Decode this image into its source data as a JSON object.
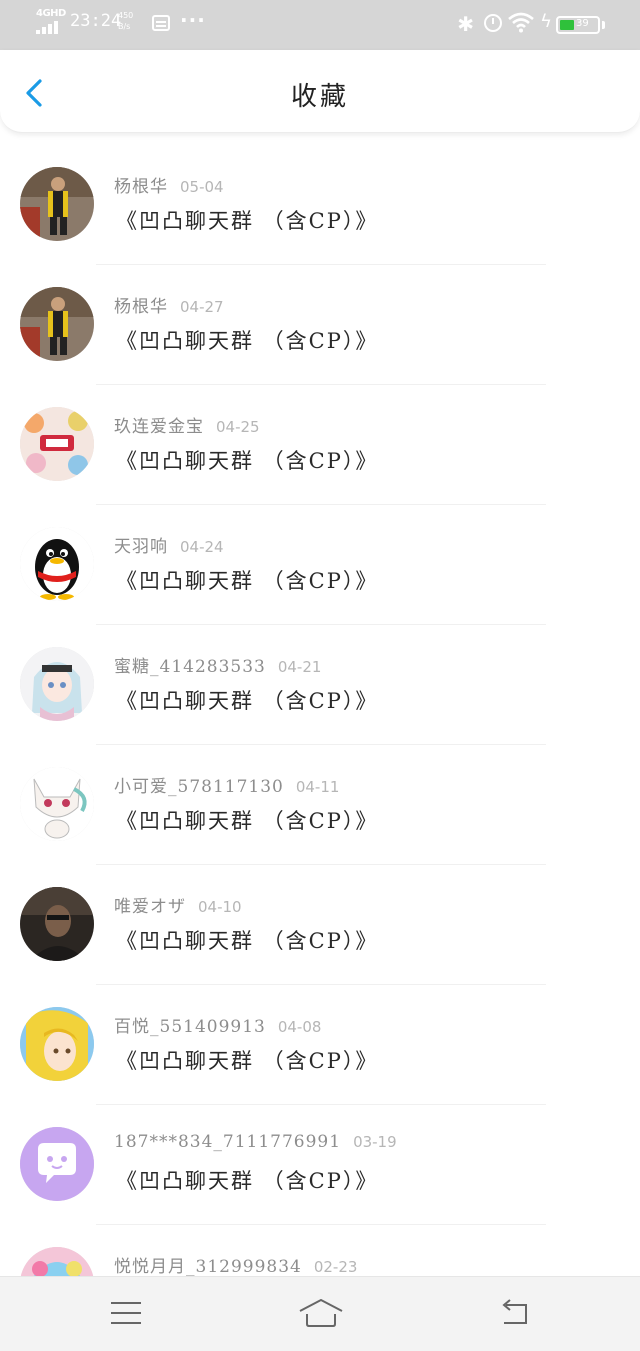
{
  "status_bar": {
    "network": "4GHD",
    "time": "23:24",
    "speed_value": "450",
    "speed_unit": "B/s",
    "battery_percent": 39,
    "battery_label": "39",
    "battery_color": "#2fc13b",
    "icons": [
      "signal-icon",
      "notification-box-icon",
      "more-dots-icon",
      "bluetooth-icon",
      "alarm-icon",
      "wifi-icon",
      "charging-icon",
      "battery-icon"
    ]
  },
  "header": {
    "title": "收藏",
    "back_icon": "chevron-left-icon",
    "accent_color": "#1a9be6"
  },
  "items": [
    {
      "sender": "杨根华",
      "date": "05-04",
      "title": "《凹凸聊天群 （含CP）》",
      "avatar": "photo-person"
    },
    {
      "sender": "杨根华",
      "date": "04-27",
      "title": "《凹凸聊天群 （含CP）》",
      "avatar": "photo-person"
    },
    {
      "sender": "玖连爱金宝",
      "date": "04-25",
      "title": "《凹凸聊天群 （含CP）》",
      "avatar": "sticker-collage"
    },
    {
      "sender": "天羽响",
      "date": "04-24",
      "title": "《凹凸聊天群 （含CP）》",
      "avatar": "penguin"
    },
    {
      "sender": "蜜糖_414283533",
      "date": "04-21",
      "title": "《凹凸聊天群 （含CP）》",
      "avatar": "anime-girl"
    },
    {
      "sender": "小可爱_578117130",
      "date": "04-11",
      "title": "《凹凸聊天群 （含CP）》",
      "avatar": "anime-cat"
    },
    {
      "sender": "唯爱オザ",
      "date": "04-10",
      "title": "《凹凸聊天群 （含CP）》",
      "avatar": "photo-dark"
    },
    {
      "sender": "百悦_551409913",
      "date": "04-08",
      "title": "《凹凸聊天群 （含CP）》",
      "avatar": "anime-blonde"
    },
    {
      "sender": "187***834_7111776991",
      "date": "03-19",
      "title": "《凹凸聊天群 （含CP）》",
      "avatar": "chat-bubble"
    },
    {
      "sender": "悦悦月月_312999834",
      "date": "02-23",
      "title": "",
      "avatar": "anime-colorful"
    }
  ],
  "nav_bar": {
    "icons": [
      "menu-icon",
      "home-icon",
      "back-icon"
    ]
  }
}
